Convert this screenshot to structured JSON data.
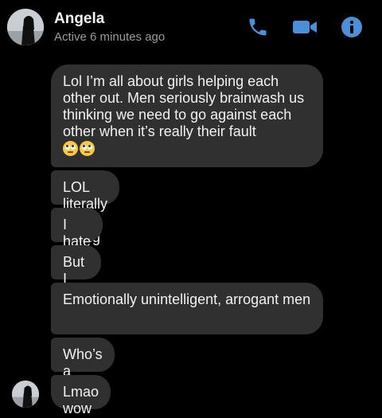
{
  "header": {
    "name": "Angela",
    "status": "Active 6 minutes ago",
    "icons": [
      "phone-icon",
      "video-camera-icon",
      "info-icon"
    ],
    "accent_color": "#4a90d9"
  },
  "messages": [
    {
      "text": "Lol I’m all about girls helping each other out. Men seriously brainwash us thinking we need to go against each other when it’s really their fault",
      "emoji": [
        "eye-roll-emoji",
        "eye-roll-emoji"
      ]
    },
    {
      "text": "LOL literally my fcking type"
    },
    {
      "text": "I hate it"
    },
    {
      "text": "But I love it"
    },
    {
      "text": "Emotionally unintelligent, arrogant men"
    },
    {
      "text": "Who’s a nerd"
    },
    {
      "text": "Lmao wow"
    }
  ],
  "colors": {
    "background": "#000000",
    "bubble": "#303030",
    "status_text": "#9a9a9a"
  }
}
